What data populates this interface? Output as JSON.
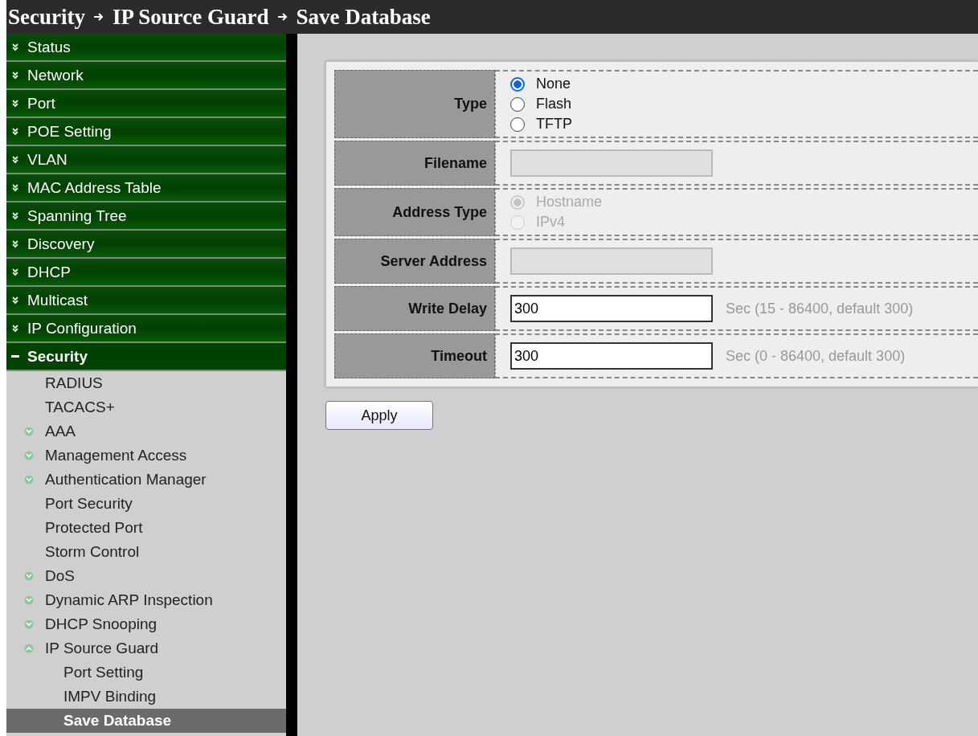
{
  "breadcrumb": [
    "Security",
    "IP Source Guard",
    "Save Database"
  ],
  "sidebar": {
    "items": [
      {
        "label": "Status",
        "expanded": false
      },
      {
        "label": "Network",
        "expanded": false
      },
      {
        "label": "Port",
        "expanded": false
      },
      {
        "label": "POE Setting",
        "expanded": false
      },
      {
        "label": "VLAN",
        "expanded": false
      },
      {
        "label": "MAC Address Table",
        "expanded": false
      },
      {
        "label": "Spanning Tree",
        "expanded": false
      },
      {
        "label": "Discovery",
        "expanded": false
      },
      {
        "label": "DHCP",
        "expanded": false
      },
      {
        "label": "Multicast",
        "expanded": false
      },
      {
        "label": "IP Configuration",
        "expanded": false
      },
      {
        "label": "Security",
        "expanded": true,
        "children": [
          {
            "label": "RADIUS",
            "kind": "leaf",
            "selected": false
          },
          {
            "label": "TACACS+",
            "kind": "leaf",
            "selected": false
          },
          {
            "label": "AAA",
            "kind": "folder",
            "expanded": false
          },
          {
            "label": "Management Access",
            "kind": "folder",
            "expanded": false
          },
          {
            "label": "Authentication Manager",
            "kind": "folder",
            "expanded": false
          },
          {
            "label": "Port Security",
            "kind": "leaf",
            "selected": false
          },
          {
            "label": "Protected Port",
            "kind": "leaf",
            "selected": false
          },
          {
            "label": "Storm Control",
            "kind": "leaf",
            "selected": false
          },
          {
            "label": "DoS",
            "kind": "folder",
            "expanded": false
          },
          {
            "label": "Dynamic ARP Inspection",
            "kind": "folder",
            "expanded": false
          },
          {
            "label": "DHCP Snooping",
            "kind": "folder",
            "expanded": false
          },
          {
            "label": "IP Source Guard",
            "kind": "folder",
            "expanded": true,
            "children": [
              {
                "label": "Port Setting",
                "selected": false
              },
              {
                "label": "IMPV Binding",
                "selected": false
              },
              {
                "label": "Save Database",
                "selected": true
              }
            ]
          }
        ]
      }
    ]
  },
  "form": {
    "rows": [
      {
        "label": "Type",
        "kind": "radio",
        "disabled": false,
        "options": [
          {
            "label": "None",
            "selected": true
          },
          {
            "label": "Flash",
            "selected": false
          },
          {
            "label": "TFTP",
            "selected": false
          }
        ]
      },
      {
        "label": "Filename",
        "kind": "text",
        "disabled": true
      },
      {
        "label": "Address Type",
        "kind": "radio",
        "disabled": true,
        "options": [
          {
            "label": "Hostname",
            "selected": true
          },
          {
            "label": "IPv4",
            "selected": false
          }
        ]
      },
      {
        "label": "Server Address",
        "kind": "text",
        "disabled": true
      },
      {
        "label": "Write Delay",
        "kind": "text",
        "disabled": false,
        "value": "300",
        "hint": "Sec (15 - 86400, default 300)"
      },
      {
        "label": "Timeout",
        "kind": "text",
        "disabled": false,
        "value": "300",
        "hint": "Sec (0 - 86400, default 300)"
      }
    ]
  },
  "buttons": [
    "Apply"
  ]
}
